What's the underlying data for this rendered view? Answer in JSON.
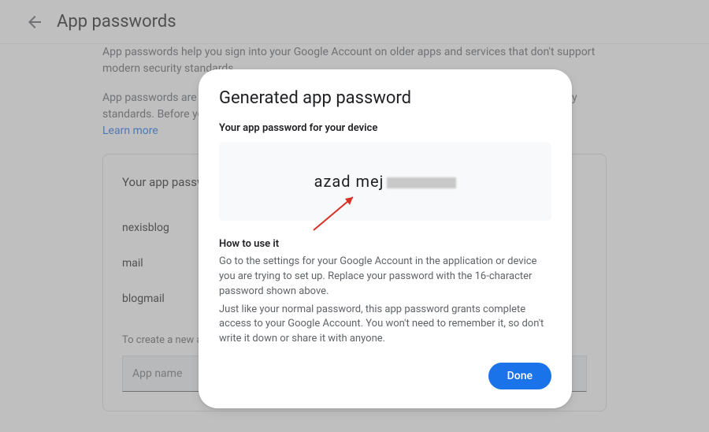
{
  "header": {
    "title": "App passwords"
  },
  "intro": {
    "p1": "App passwords help you sign into your Google Account on older apps and services that don't support modern security standards.",
    "p2": "App passwords are less secure than using up-to-date apps and services that use modern security standards. Before you create an app password, you should check to see if your app needs this.",
    "learn_more": "Learn more"
  },
  "panel": {
    "title": "Your app passwords",
    "items": [
      "nexisblog",
      "mail",
      "blogmail"
    ],
    "create_label": "To create a new app specific password, type a name for it below…",
    "input_placeholder": "App name"
  },
  "modal": {
    "title": "Generated app password",
    "subtitle": "Your app password for your device",
    "password_visible": "azad mej",
    "how_title": "How to use it",
    "how_p1": "Go to the settings for your Google Account in the application or device you are trying to set up. Replace your password with the 16-character password shown above.",
    "how_p2": "Just like your normal password, this app password grants complete access to your Google Account. You won't need to remember it, so don't write it down or share it with anyone.",
    "done": "Done"
  }
}
